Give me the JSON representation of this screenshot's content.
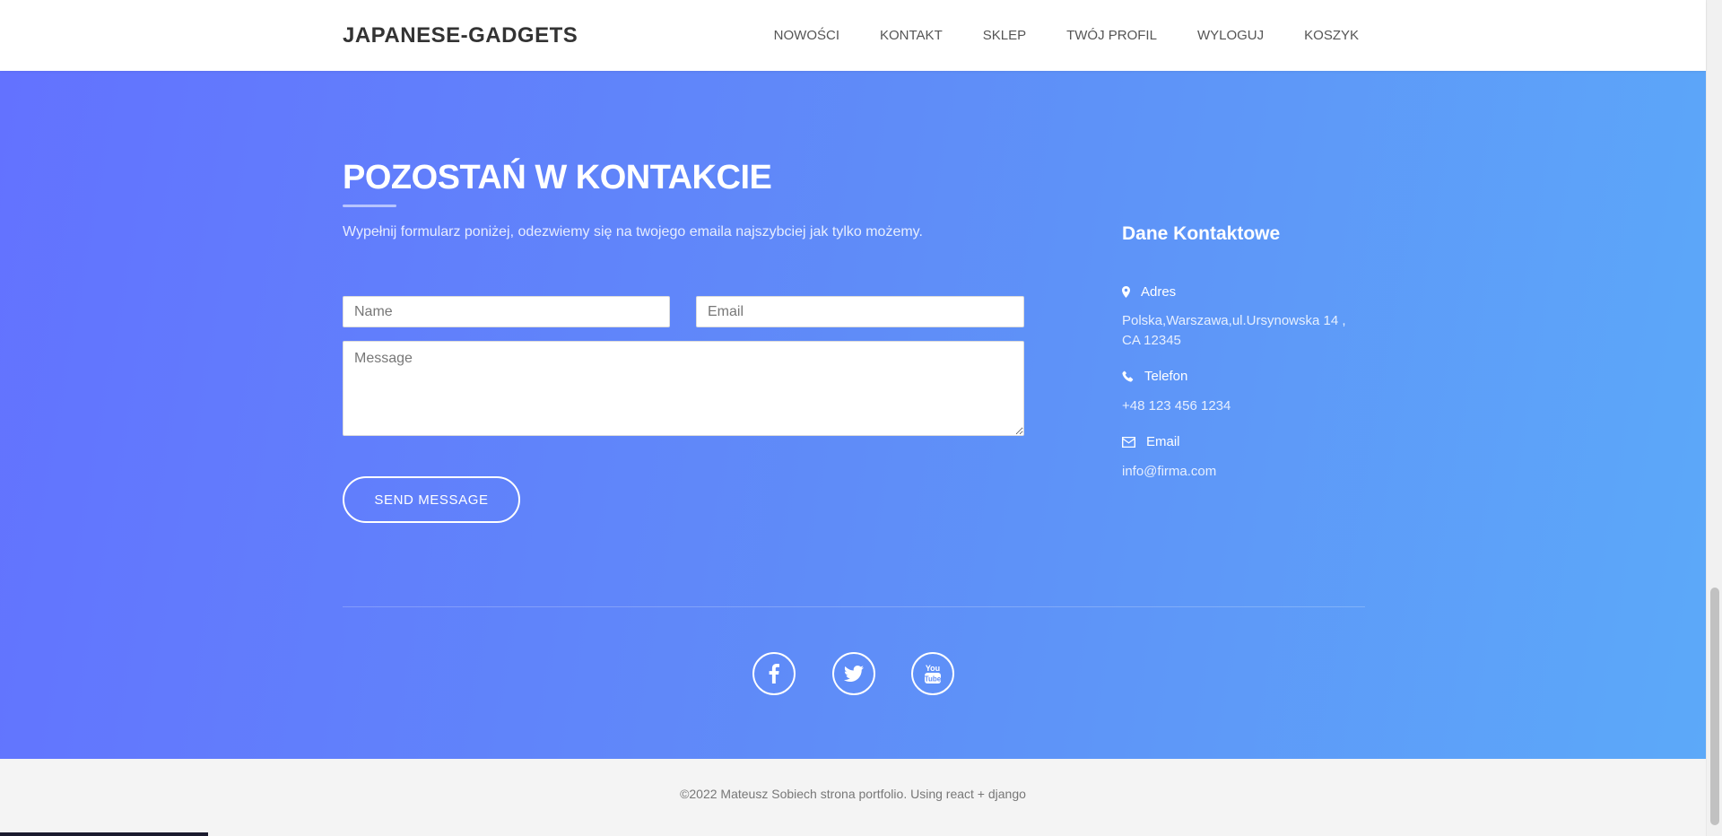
{
  "brand": "JAPANESE-GADGETS",
  "nav": [
    "NOWOŚCI",
    "KONTAKT",
    "SKLEP",
    "TWÓJ PROFIL",
    "WYLOGUJ",
    "KOSZYK"
  ],
  "contact": {
    "title": "POZOSTAŃ W KONTAKCIE",
    "lead": "Wypełnij formularz poniżej, odezwiemy się na twojego emaila najszybciej jak tylko możemy.",
    "name_placeholder": "Name",
    "email_placeholder": "Email",
    "message_placeholder": "Message",
    "send_label": "SEND MESSAGE"
  },
  "info": {
    "title": "Dane Kontaktowe",
    "address_label": "Adres",
    "address_value": "Polska,Warszawa,ul.Ursynowska 14 , CA 12345",
    "phone_label": "Telefon",
    "phone_value": "+48 123 456 1234",
    "email_label": "Email",
    "email_value": "info@firma.com"
  },
  "social": [
    "facebook-icon",
    "twitter-icon",
    "youtube-icon"
  ],
  "footer": {
    "copyright": "©2022 Mateusz Sobiech strona portfolio. Using react + django"
  },
  "colors": {
    "gradient_start": "#6372ff",
    "gradient_end": "#5ca9f9",
    "footer_bg": "#f4f4f4"
  }
}
